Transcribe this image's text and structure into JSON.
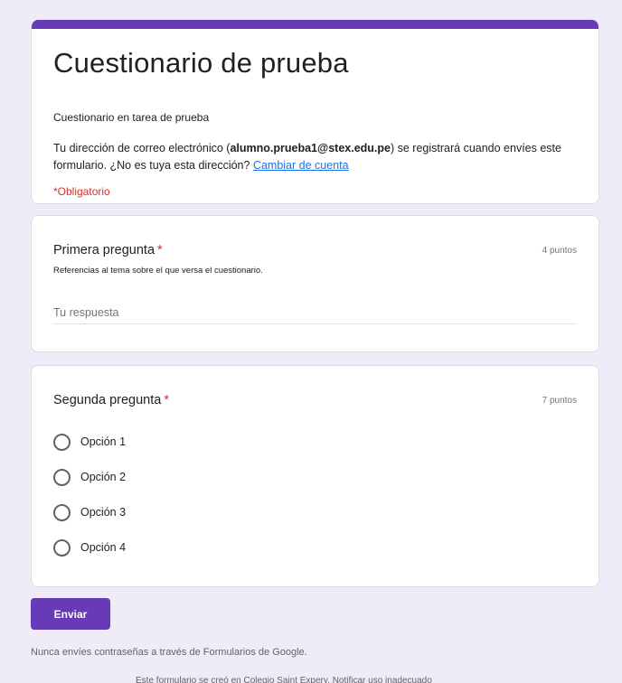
{
  "colors": {
    "accent": "#673ab7",
    "required": "#d93025",
    "link": "#1a73e8",
    "background": "#f0ebf8"
  },
  "header": {
    "title": "Cuestionario de prueba",
    "description": "Cuestionario en tarea de prueba",
    "email_prefix": "Tu dirección de correo electrónico (",
    "email": "alumno.prueba1@stex.edu.pe",
    "email_suffix": ") se registrará cuando envíes este formulario. ¿No es tuya esta dirección? ",
    "switch_account": "Cambiar de cuenta",
    "required_note": "*Obligatorio"
  },
  "question1": {
    "title": "Primera pregunta",
    "required_mark": "*",
    "points": "4 puntos",
    "help": "Referencias al tema sobre el que versa el cuestionario.",
    "placeholder": "Tu respuesta"
  },
  "question2": {
    "title": "Segunda pregunta",
    "required_mark": "*",
    "points": "7 puntos",
    "options": [
      "Opción 1",
      "Opción 2",
      "Opción 3",
      "Opción 4"
    ]
  },
  "submit_label": "Enviar",
  "footer": {
    "warning": "Nunca envíes contraseñas a través de Formularios de Google.",
    "note": "Este formulario se creó en Colegio Saint Expery. Notificar uso inadecuado"
  }
}
